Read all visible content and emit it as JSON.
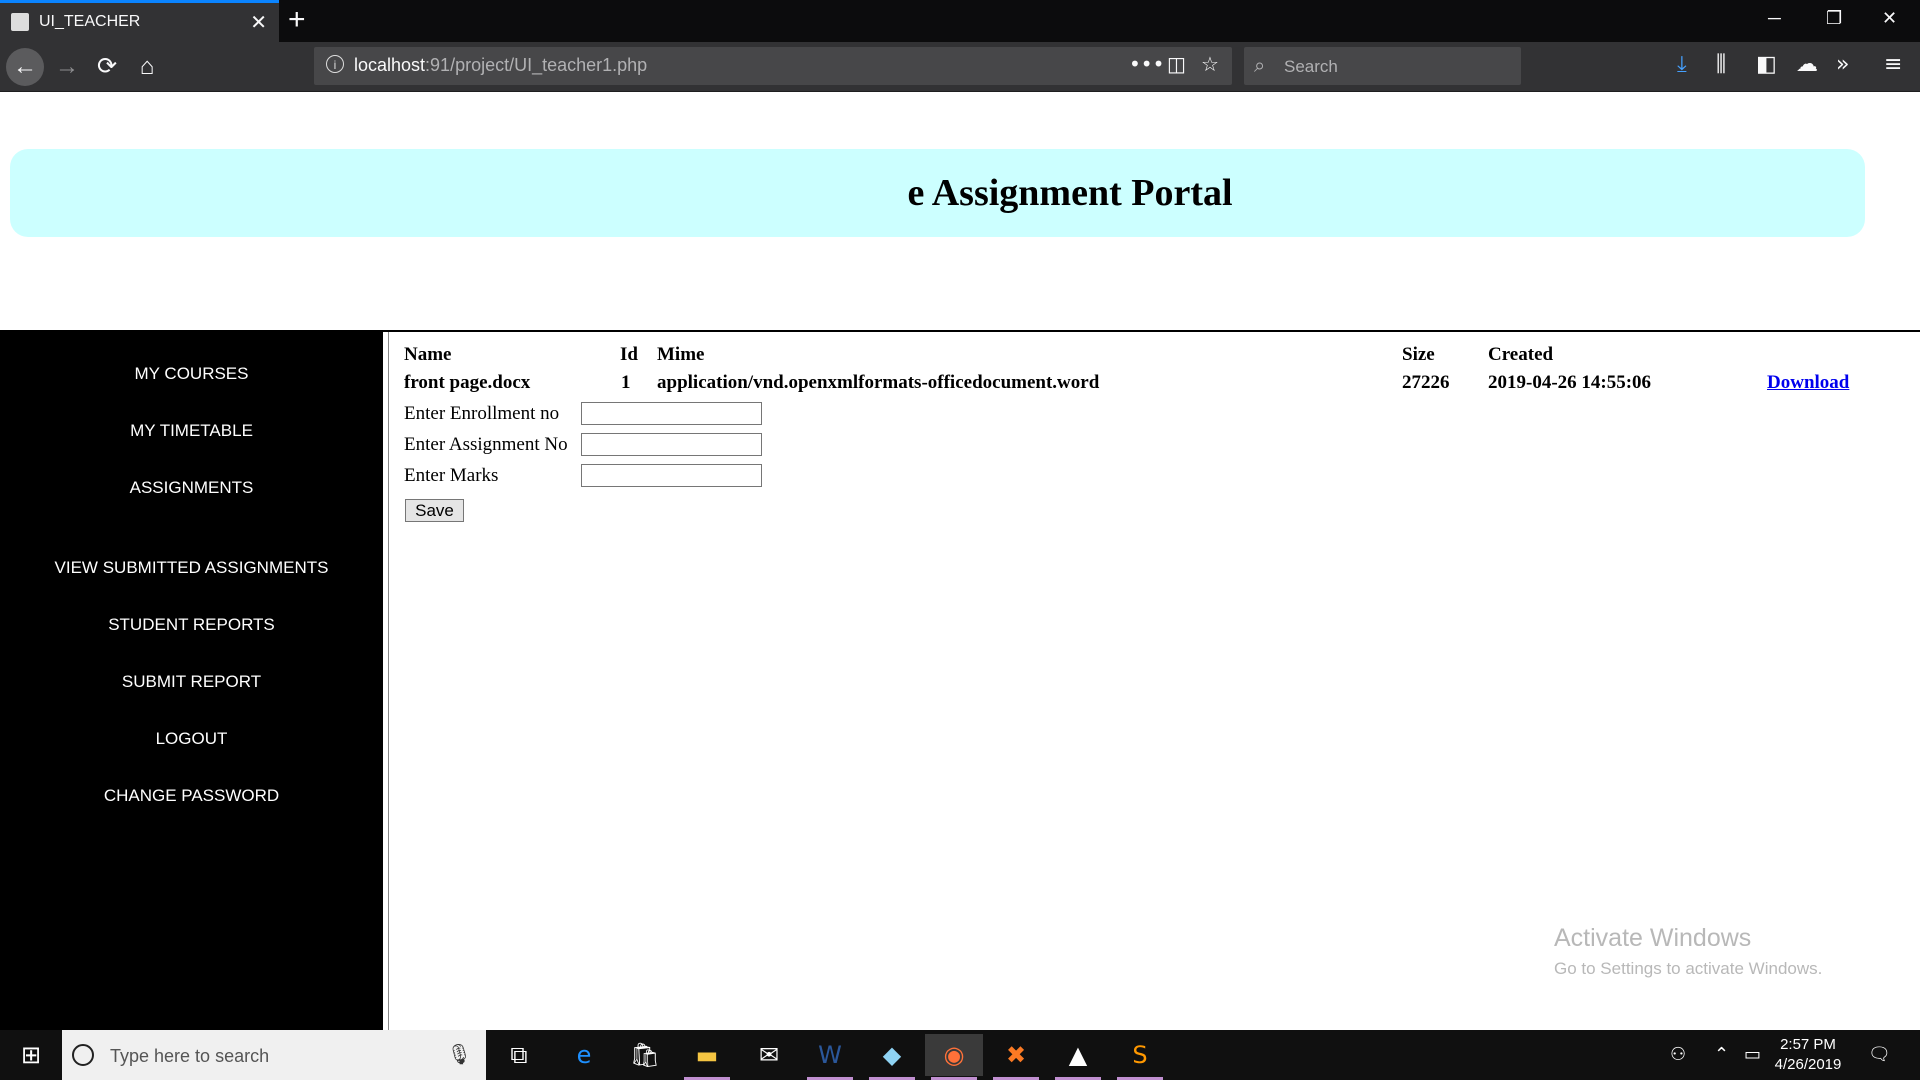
{
  "browser": {
    "tab_title": "UI_TEACHER",
    "tab_close": "✕",
    "new_tab": "+",
    "url_host": "localhost",
    "url_rest": ":91/project/UI_teacher1.php",
    "search_placeholder": "Search",
    "window_controls": {
      "minimize": "─",
      "restore": "❐",
      "close": "✕"
    }
  },
  "page": {
    "title": "e Assignment Portal",
    "sidebar": {
      "items": [
        {
          "label": "MY COURSES"
        },
        {
          "label": "MY TIMETABLE"
        },
        {
          "label": "ASSIGNMENTS"
        },
        {
          "label": "VIEW SUBMITTED ASSIGNMENTS"
        },
        {
          "label": "STUDENT REPORTS"
        },
        {
          "label": "SUBMIT REPORT"
        },
        {
          "label": "LOGOUT"
        },
        {
          "label": "CHANGE PASSWORD"
        }
      ]
    },
    "table": {
      "headers": {
        "name": "Name",
        "id": "Id",
        "mime": "Mime",
        "size": "Size",
        "created": "Created"
      },
      "rows": [
        {
          "name": "front page.docx",
          "id": "1",
          "mime": "application/vnd.openxmlformats-officedocument.word",
          "size": "27226",
          "created": "2019-04-26 14:55:06",
          "action": "Download"
        }
      ]
    },
    "form": {
      "enrollment_label": "Enter Enrollment no",
      "enrollment_value": "",
      "assignment_label": "Enter Assignment No",
      "assignment_value": "",
      "marks_label": "Enter Marks",
      "marks_value": "",
      "save_label": "Save"
    },
    "watermark": {
      "line1": "Activate Windows",
      "line2": "Go to Settings to activate Windows."
    }
  },
  "taskbar": {
    "search_placeholder": "Type here to search",
    "time": "2:57 PM",
    "date": "4/26/2019"
  },
  "colors": {
    "banner_bg": "#ccffff",
    "sidebar_bg": "#000000",
    "link": "#0000ee",
    "tab_accent": "#0a84ff"
  }
}
